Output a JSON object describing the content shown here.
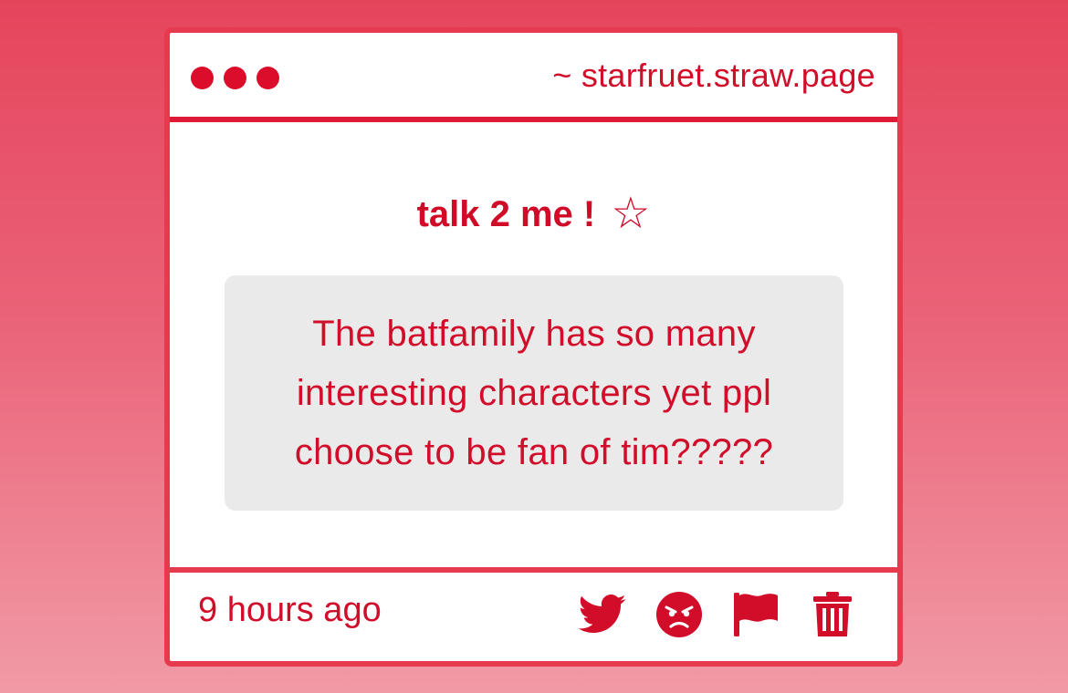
{
  "window": {
    "url": "~ starfruet.straw.page",
    "controls": [
      "dot",
      "dot",
      "dot"
    ]
  },
  "prompt": {
    "title": "talk 2 me !",
    "title_icon": "☆"
  },
  "message": {
    "text": "The batfamily has so many interesting characters yet ppl choose to be fan of tim?????"
  },
  "footer": {
    "timestamp": "9 hours ago",
    "actions": [
      {
        "name": "twitter-icon"
      },
      {
        "name": "angry-face-icon"
      },
      {
        "name": "flag-icon"
      },
      {
        "name": "trash-icon"
      }
    ]
  },
  "colors": {
    "accent": "#d10d2a",
    "border": "#e73a4e",
    "message_bg": "#ebeaeb",
    "background_top": "#e5455c",
    "background_bottom": "#f19aa6"
  }
}
